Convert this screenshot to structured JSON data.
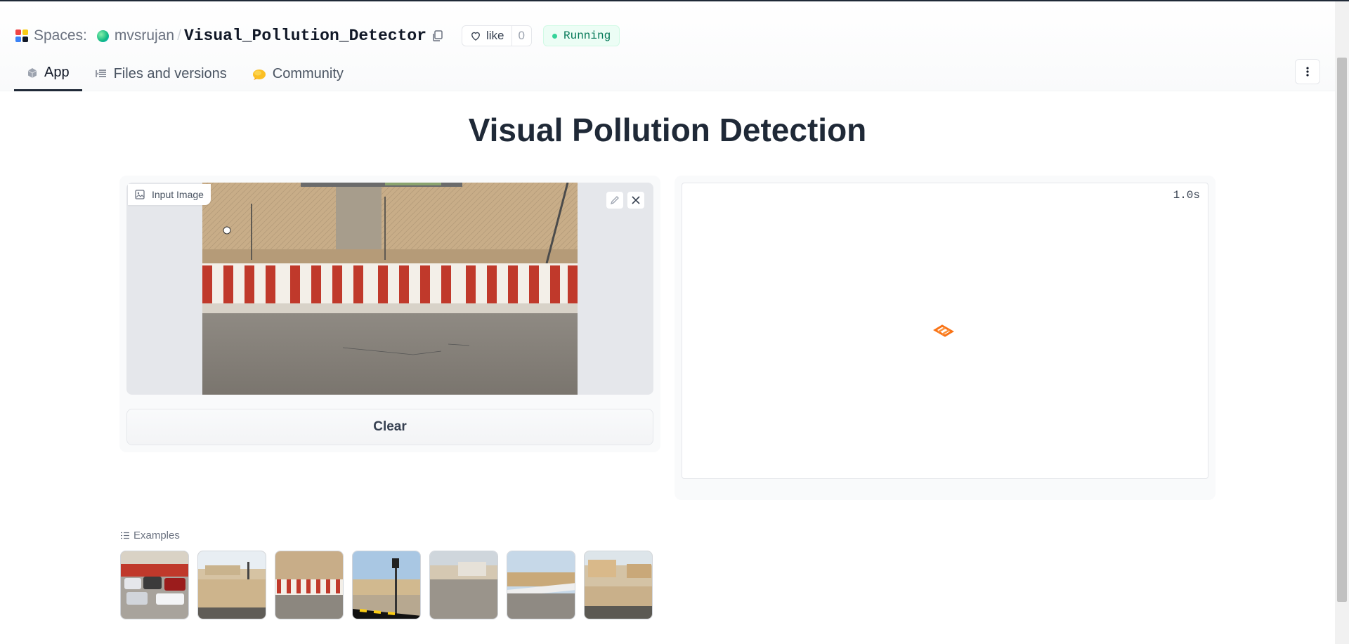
{
  "header": {
    "spaces_label": "Spaces:",
    "owner": "mvsrujan",
    "separator": "/",
    "repo_name": "Visual_Pollution_Detector",
    "like_label": "like",
    "like_count": "0",
    "status": "Running",
    "colors": {
      "status_bg": "#ecfdf5",
      "status_text": "#047857",
      "status_dot": "#34d399"
    }
  },
  "tabs": [
    {
      "label": "App",
      "icon": "cube-icon",
      "active": true
    },
    {
      "label": "Files and versions",
      "icon": "files-icon",
      "active": false
    },
    {
      "label": "Community",
      "icon": "community-icon",
      "active": false
    }
  ],
  "main": {
    "title": "Visual Pollution Detection",
    "input": {
      "label": "Input Image",
      "image_alt": "road with red and white barriers",
      "edit_icon": "pencil-icon",
      "close_icon": "close-icon"
    },
    "clear_label": "Clear",
    "output": {
      "timer": "1.0s",
      "loader_icon": "loading-icon",
      "accent": "#f97316"
    }
  },
  "examples": {
    "label": "Examples",
    "items": [
      {
        "name": "example-cars-parking"
      },
      {
        "name": "example-sandy-road"
      },
      {
        "name": "example-barrier-road"
      },
      {
        "name": "example-street-sign"
      },
      {
        "name": "example-buildings-road"
      },
      {
        "name": "example-curb-road"
      },
      {
        "name": "example-brick-sidewalk"
      }
    ]
  }
}
